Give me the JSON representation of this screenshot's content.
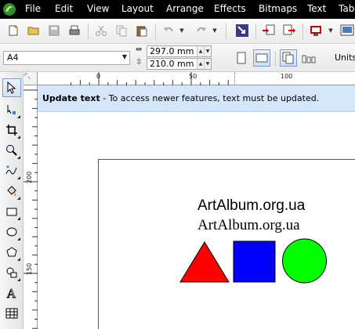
{
  "menu": {
    "items": [
      "File",
      "Edit",
      "View",
      "Layout",
      "Arrange",
      "Effects",
      "Bitmaps",
      "Text",
      "Tab"
    ]
  },
  "toolbar": {
    "icons": [
      "new-document-icon",
      "open-icon",
      "save-icon",
      "print-icon",
      "cut-icon",
      "copy-icon",
      "paste-icon",
      "undo-icon",
      "redo-icon",
      "app-launcher-icon",
      "import-icon",
      "export-icon",
      "publish-pdf-icon",
      "welcome-screen-icon"
    ]
  },
  "property_bar": {
    "page_size": "A4",
    "width": "297.0 mm",
    "height": "210.0 mm",
    "units_label": "Units:"
  },
  "rulers": {
    "top_labels": [
      "0",
      "50",
      "100"
    ],
    "left_labels": [
      "200",
      "150"
    ]
  },
  "notice": {
    "title": "Update text",
    "message": "- To access newer features, text must be updated."
  },
  "document": {
    "text_sans": "ArtAlbum.org.ua",
    "text_serif": "ArtAlbum.org.ua",
    "shapes": [
      {
        "type": "triangle",
        "fill": "#ff0000"
      },
      {
        "type": "square",
        "fill": "#0000ff"
      },
      {
        "type": "circle",
        "fill": "#00ff00"
      }
    ]
  },
  "colors": {
    "menubar_bg": "#000000",
    "notice_bg": "#d6e6fa",
    "accent": "#7a9cd3"
  },
  "toolbox": {
    "tools": [
      "pick-tool-icon",
      "shape-tool-icon",
      "crop-tool-icon",
      "zoom-tool-icon",
      "freehand-tool-icon",
      "smart-fill-tool-icon",
      "rectangle-tool-icon",
      "ellipse-tool-icon",
      "polygon-tool-icon",
      "basic-shapes-tool-icon",
      "text-tool-icon",
      "table-tool-icon"
    ]
  }
}
